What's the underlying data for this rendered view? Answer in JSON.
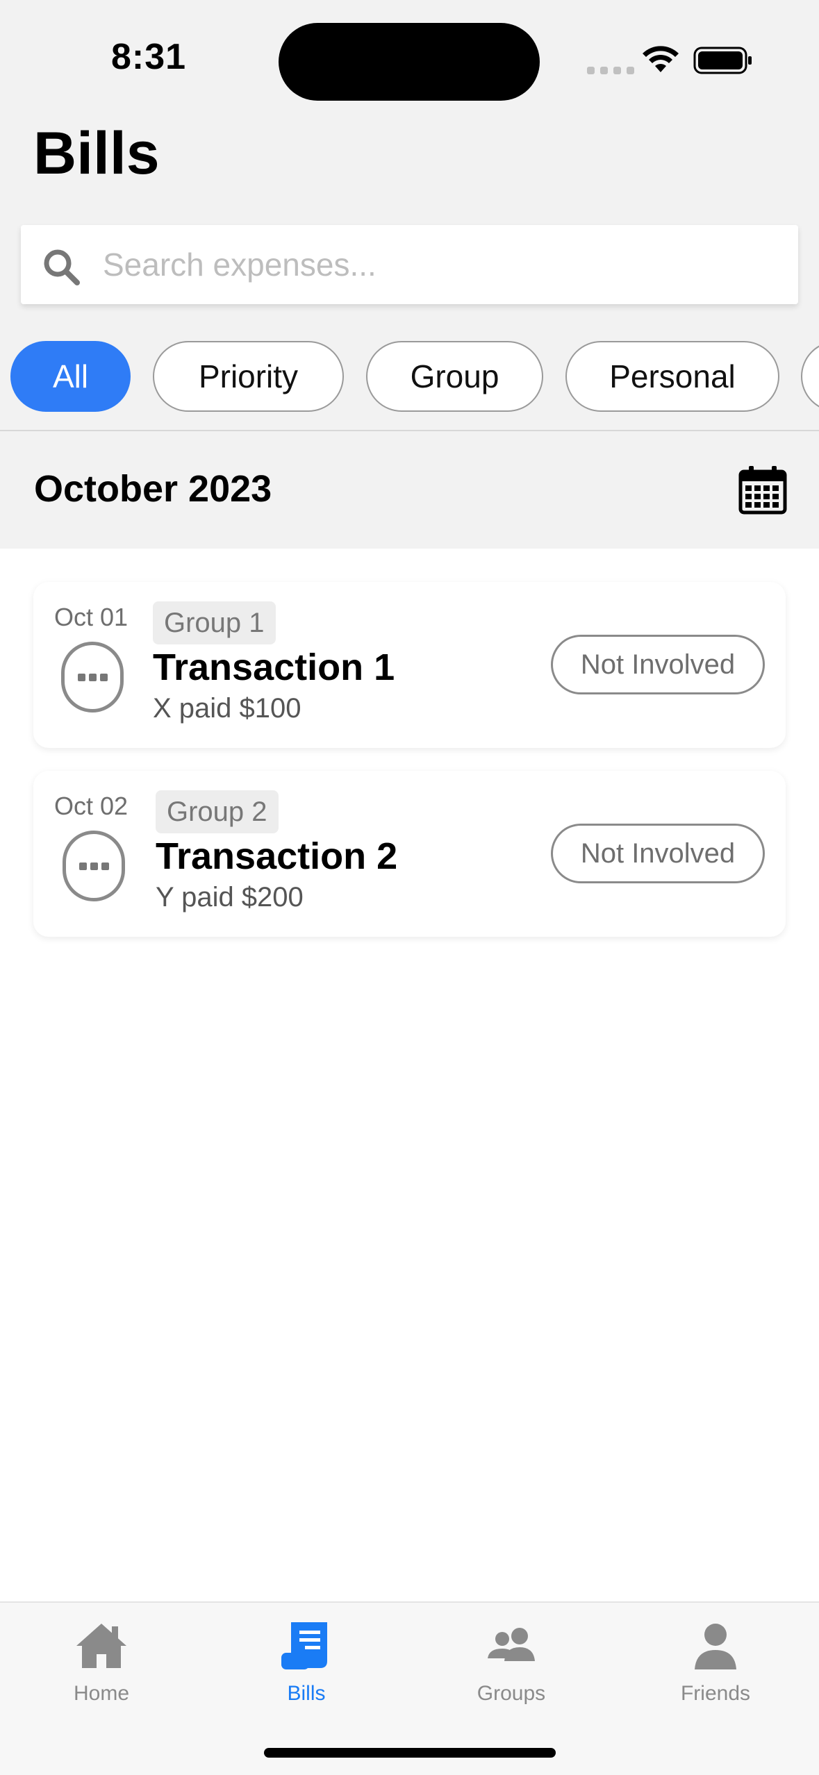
{
  "status_bar": {
    "time": "8:31"
  },
  "header": {
    "title": "Bills"
  },
  "search": {
    "placeholder": "Search expenses...",
    "value": "",
    "icon": "search-icon"
  },
  "filters": [
    {
      "label": "All",
      "active": true
    },
    {
      "label": "Priority",
      "active": false
    },
    {
      "label": "Group",
      "active": false
    },
    {
      "label": "Personal",
      "active": false
    }
  ],
  "month": {
    "title": "October 2023",
    "icon": "calendar-icon"
  },
  "transactions": [
    {
      "date": "Oct 01",
      "group": "Group 1",
      "title": "Transaction 1",
      "subtitle": "X paid $100",
      "status": "Not Involved"
    },
    {
      "date": "Oct 02",
      "group": "Group 2",
      "title": "Transaction 2",
      "subtitle": "Y paid $200",
      "status": "Not Involved"
    }
  ],
  "tabs": [
    {
      "label": "Home",
      "icon": "home-icon",
      "active": false
    },
    {
      "label": "Bills",
      "icon": "bills-icon",
      "active": true
    },
    {
      "label": "Groups",
      "icon": "groups-icon",
      "active": false
    },
    {
      "label": "Friends",
      "icon": "friends-icon",
      "active": false
    }
  ],
  "colors": {
    "accent": "#2f7cf6",
    "tab_active": "#1a7cf5",
    "muted": "#8a8a8a",
    "header_bg": "#f2f2f2"
  }
}
